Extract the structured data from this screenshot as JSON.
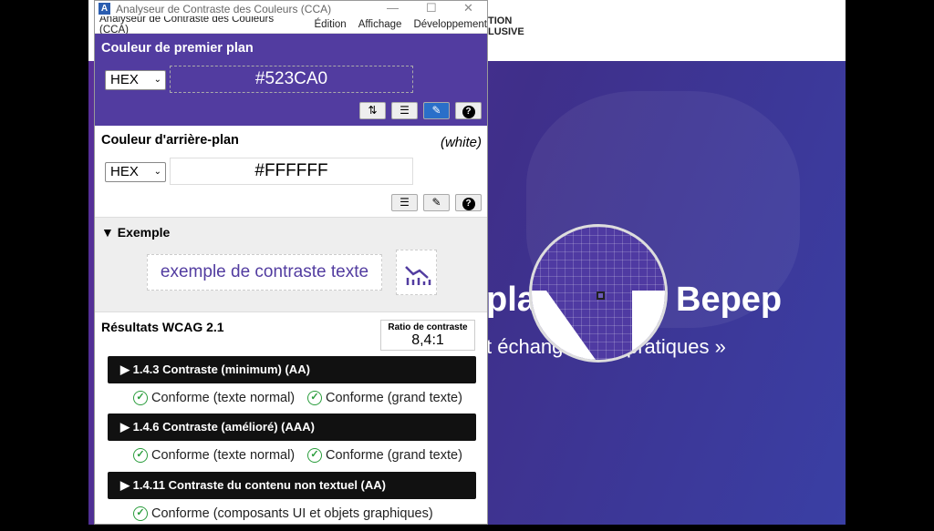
{
  "window": {
    "title": "Analyseur de Contraste des Couleurs (CCA)",
    "menu": [
      "Analyseur de Contraste des Couleurs (CCA)",
      "Édition",
      "Affichage",
      "Développement"
    ]
  },
  "foreground": {
    "heading": "Couleur de premier plan",
    "format": "HEX",
    "value": "#523CA0",
    "color": "#523CA0"
  },
  "background": {
    "heading": "Couleur d'arrière-plan",
    "name": "(white)",
    "format": "HEX",
    "value": "#FFFFFF"
  },
  "example": {
    "heading": "▼ Exemple",
    "text": "exemple de contraste texte"
  },
  "results": {
    "heading": "Résultats WCAG 2.1",
    "ratio_label": "Ratio de contraste",
    "ratio": "8,4:1",
    "criteria": [
      {
        "title": "▶ 1.4.3 Contraste (minimum) (AA)",
        "checks": [
          "Conforme (texte normal)",
          "Conforme (grand texte)"
        ]
      },
      {
        "title": "▶ 1.4.6 Contraste (amélioré) (AAA)",
        "checks": [
          "Conforme (texte normal)",
          "Conforme (grand texte)"
        ]
      },
      {
        "title": "▶ 1.4.11 Contraste du contenu non textuel (AA)",
        "checks": [
          "Conforme (composants UI et objets graphiques)"
        ]
      }
    ]
  },
  "webpage": {
    "logo_line1": "TION",
    "logo_line2": "LUSIVE",
    "hero_title_a": "pla",
    "hero_title_b": "Bepep",
    "hero_sub_a": "t échang",
    "hero_sub_b": "pratiques »"
  }
}
